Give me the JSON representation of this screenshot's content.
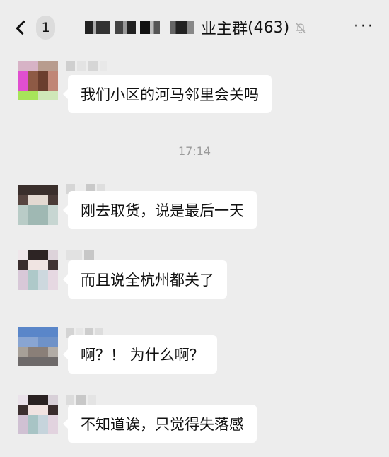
{
  "header": {
    "unread_count": "1",
    "group_name": "业主群",
    "member_count": "(463)",
    "muted_icon": "bell-slash-icon",
    "more_label": "···"
  },
  "messages": [
    {
      "text": "我们小区的河马邻里会关吗"
    },
    {
      "text": "刚去取货，说是最后一天"
    },
    {
      "text": "而且说全杭州都关了"
    },
    {
      "text": "啊？！ 为什么啊？"
    },
    {
      "text": "不知道诶，只觉得失落感"
    }
  ],
  "timestamp": "17:14"
}
